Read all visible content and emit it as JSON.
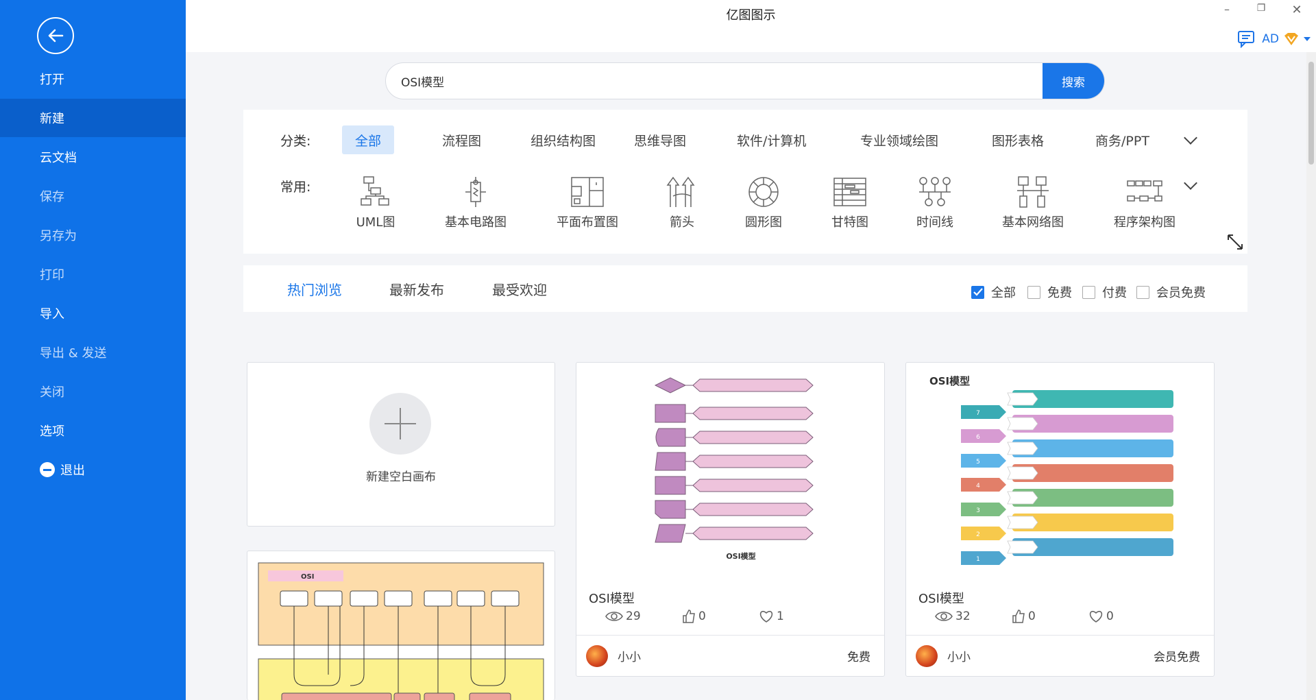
{
  "app": {
    "title": "亿图图示",
    "user": "AD"
  },
  "sidebar": {
    "items": [
      {
        "label": "打开"
      },
      {
        "label": "新建"
      },
      {
        "label": "云文档"
      },
      {
        "label": "保存"
      },
      {
        "label": "另存为"
      },
      {
        "label": "打印"
      },
      {
        "label": "导入"
      },
      {
        "label": "导出 & 发送"
      },
      {
        "label": "关闭"
      },
      {
        "label": "选项"
      },
      {
        "label": "退出"
      }
    ]
  },
  "search": {
    "value": "OSI模型",
    "button": "搜索"
  },
  "filters": {
    "category_label": "分类:",
    "categories": [
      "全部",
      "流程图",
      "组织结构图",
      "思维导图",
      "软件/计算机",
      "专业领域绘图",
      "图形表格",
      "商务/PPT"
    ],
    "common_label": "常用:",
    "common": [
      "UML图",
      "基本电路图",
      "平面布置图",
      "箭头",
      "圆形图",
      "甘特图",
      "时间线",
      "基本网络图",
      "程序架构图"
    ]
  },
  "tabs": [
    "热门浏览",
    "最新发布",
    "最受欢迎"
  ],
  "price_filters": [
    "全部",
    "免费",
    "付费",
    "会员免费"
  ],
  "new_canvas": "新建空白画布",
  "templates": [
    {
      "title": "OSI模型",
      "views": "29",
      "likes": "0",
      "favs": "1",
      "author": "小小",
      "price": "免费"
    },
    {
      "title": "OSI模型",
      "views": "32",
      "likes": "0",
      "favs": "0",
      "author": "小小",
      "price": "会员免费",
      "thumb_title": "OSI模型"
    }
  ],
  "thumb1_caption": "OSI模型",
  "thumb3_caption": "OSI",
  "osi_layers": [
    "7",
    "6",
    "5",
    "4",
    "3",
    "2",
    "1"
  ]
}
